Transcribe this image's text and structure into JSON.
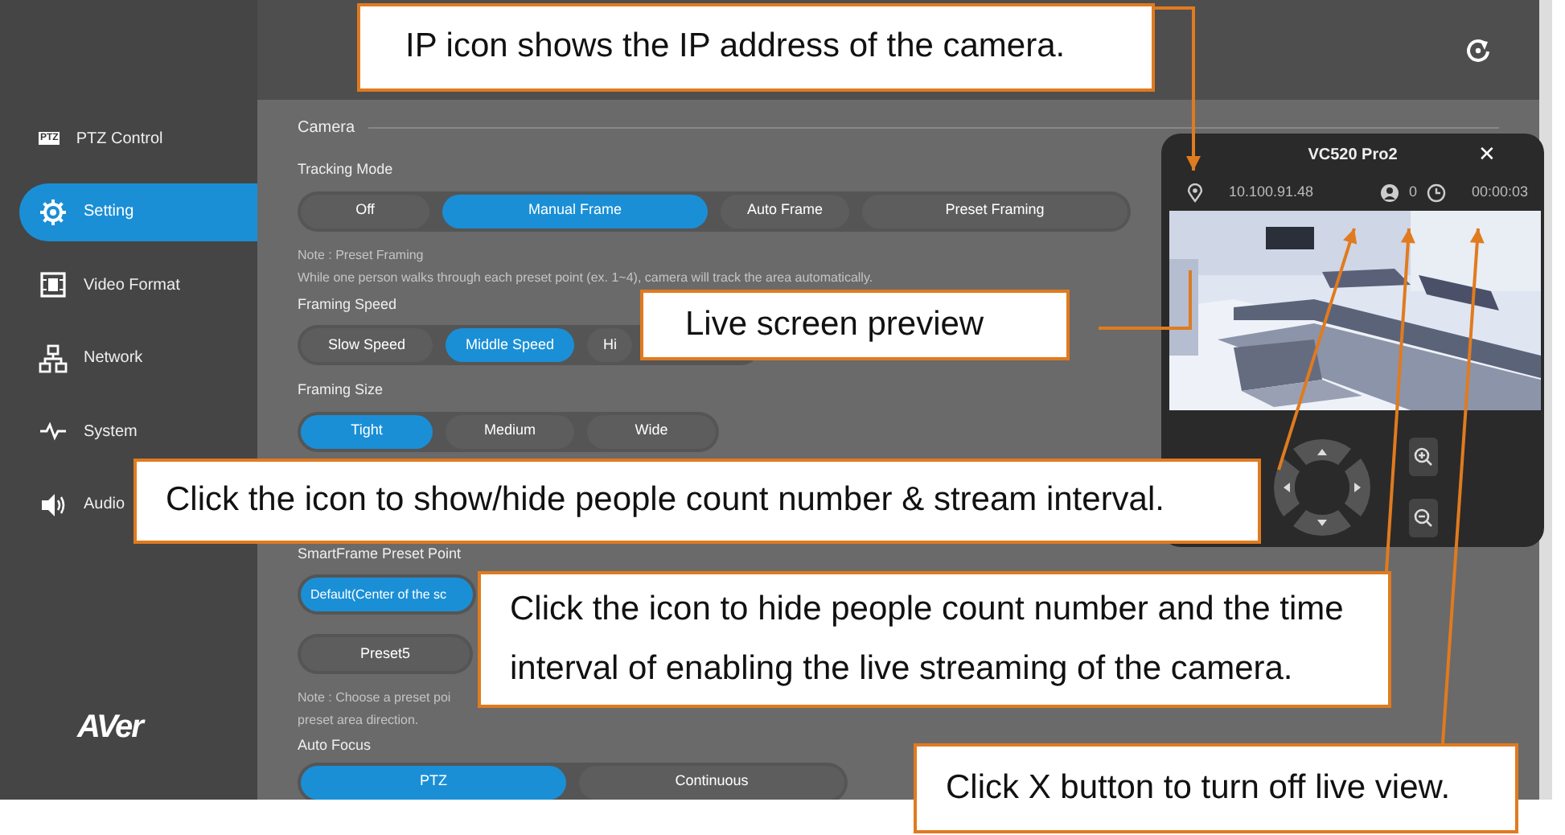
{
  "sidebar": {
    "items": [
      {
        "label": "PTZ Control",
        "icon_text": "PTZ",
        "selected": false
      },
      {
        "label": "Setting",
        "selected": true
      },
      {
        "label": "Video Format",
        "selected": false
      },
      {
        "label": "Network",
        "selected": false
      },
      {
        "label": "System",
        "selected": false
      },
      {
        "label": "Audio",
        "selected": false
      }
    ],
    "logo": "AVer"
  },
  "settings": {
    "section_title": "Camera",
    "groups": [
      {
        "label": "Tracking Mode",
        "rows": [
          [
            {
              "label": "Off",
              "selected": false
            },
            {
              "label": "Manual Frame",
              "selected": true
            },
            {
              "label": "Auto Frame",
              "selected": false
            },
            {
              "label": "Preset Framing",
              "selected": false
            }
          ]
        ],
        "note": [
          "Note : Preset Framing",
          "While one person walks through each preset point (ex. 1~4), camera will track the area automatically."
        ]
      },
      {
        "label": "Framing Speed",
        "rows": [
          [
            {
              "label": "Slow Speed",
              "selected": false
            },
            {
              "label": "Middle Speed",
              "selected": true
            },
            {
              "label": "Hi",
              "selected": false
            }
          ]
        ]
      },
      {
        "label": "Framing Size",
        "rows": [
          [
            {
              "label": "Tight",
              "selected": true
            },
            {
              "label": "Medium",
              "selected": false
            },
            {
              "label": "Wide",
              "selected": false
            }
          ]
        ]
      },
      {
        "label": "SmartFrame Preset Point",
        "rows": [
          [
            {
              "label": "Default(Center of the sc",
              "selected": true
            }
          ],
          [
            {
              "label": "Preset5",
              "selected": false
            }
          ]
        ],
        "note": [
          "Note : Choose a preset poi",
          "preset area direction."
        ]
      },
      {
        "label": "Auto Focus",
        "rows": [
          [
            {
              "label": "PTZ",
              "selected": true
            },
            {
              "label": "Continuous",
              "selected": false
            }
          ]
        ]
      }
    ]
  },
  "live_view": {
    "title": "VC520 Pro2",
    "close": "✕",
    "ip": "10.100.91.48",
    "people_count": "0",
    "timer": "00:00:03"
  },
  "callouts": [
    {
      "text": "IP icon shows the IP address of the camera."
    },
    {
      "text": "Live screen preview"
    },
    {
      "text": "Click the icon to show/hide people count number & stream interval."
    },
    {
      "text": "Click the icon to hide people count number and the time interval of enabling the live streaming of the camera."
    },
    {
      "text": "Click X button to turn off live view."
    }
  ]
}
